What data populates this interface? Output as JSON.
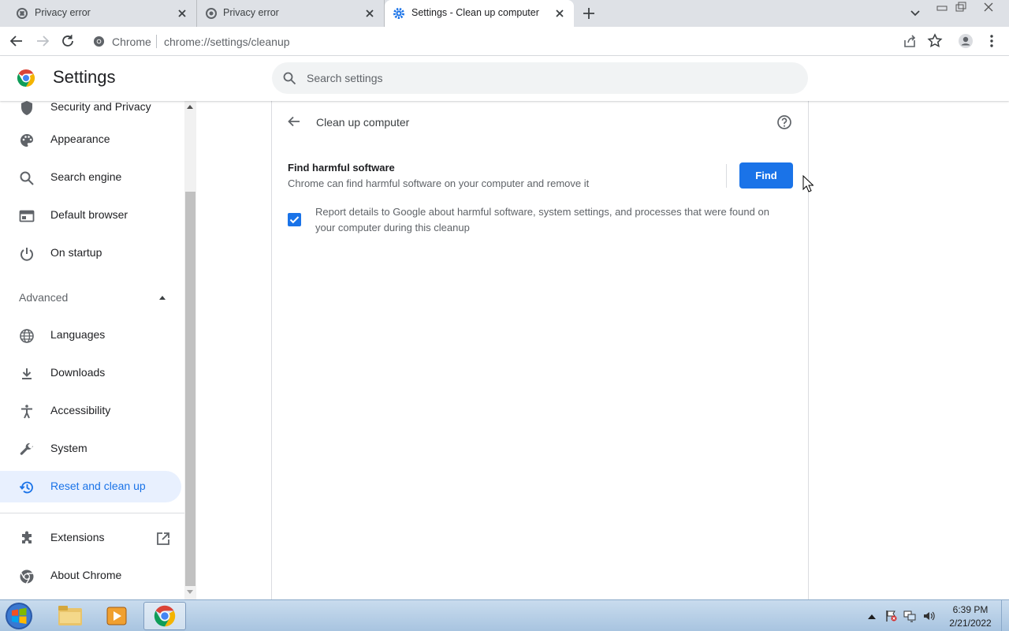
{
  "tabs": [
    {
      "title": "Privacy error",
      "icon": "globe-icon",
      "active": false
    },
    {
      "title": "Privacy error",
      "icon": "globe-icon",
      "active": false
    },
    {
      "title": "Settings - Clean up computer",
      "icon": "gear-icon",
      "active": true
    }
  ],
  "omnibox": {
    "site_label": "Chrome",
    "url": "chrome://settings/cleanup"
  },
  "header": {
    "title": "Settings",
    "search_placeholder": "Search settings"
  },
  "sidebar": {
    "items": [
      {
        "label": "Security and Privacy",
        "icon": "shield-icon"
      },
      {
        "label": "Appearance",
        "icon": "palette-icon"
      },
      {
        "label": "Search engine",
        "icon": "search-icon"
      },
      {
        "label": "Default browser",
        "icon": "browser-window-icon"
      },
      {
        "label": "On startup",
        "icon": "power-icon"
      }
    ],
    "advanced_label": "Advanced",
    "advanced_items": [
      {
        "label": "Languages",
        "icon": "globe-icon"
      },
      {
        "label": "Downloads",
        "icon": "download-icon"
      },
      {
        "label": "Accessibility",
        "icon": "accessibility-icon"
      },
      {
        "label": "System",
        "icon": "wrench-icon"
      },
      {
        "label": "Reset and clean up",
        "icon": "restore-icon",
        "selected": true
      }
    ],
    "footer_items": [
      {
        "label": "Extensions",
        "icon": "puzzle-icon"
      },
      {
        "label": "About Chrome",
        "icon": "chrome-icon"
      }
    ]
  },
  "page": {
    "title": "Clean up computer",
    "find_title": "Find harmful software",
    "find_desc": "Chrome can find harmful software on your computer and remove it",
    "find_button": "Find",
    "report_checked": true,
    "report_text": "Report details to Google about harmful software, system settings, and processes that were found on your computer during this cleanup"
  },
  "taskbar": {
    "time": "6:39 PM",
    "date": "2/21/2022"
  },
  "colors": {
    "accent": "#1a73e8",
    "selected_bg": "#e8f0fe"
  }
}
